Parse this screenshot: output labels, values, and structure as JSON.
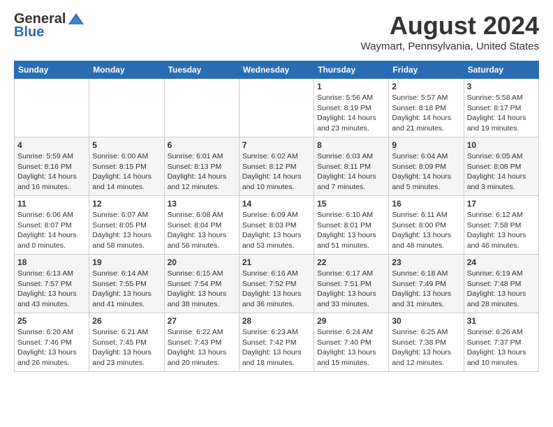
{
  "header": {
    "logo_general": "General",
    "logo_blue": "Blue",
    "month_year": "August 2024",
    "location": "Waymart, Pennsylvania, United States"
  },
  "weekdays": [
    "Sunday",
    "Monday",
    "Tuesday",
    "Wednesday",
    "Thursday",
    "Friday",
    "Saturday"
  ],
  "weeks": [
    [
      {
        "day": "",
        "sunrise": "",
        "sunset": "",
        "daylight": ""
      },
      {
        "day": "",
        "sunrise": "",
        "sunset": "",
        "daylight": ""
      },
      {
        "day": "",
        "sunrise": "",
        "sunset": "",
        "daylight": ""
      },
      {
        "day": "",
        "sunrise": "",
        "sunset": "",
        "daylight": ""
      },
      {
        "day": "1",
        "sunrise": "Sunrise: 5:56 AM",
        "sunset": "Sunset: 8:19 PM",
        "daylight": "Daylight: 14 hours and 23 minutes."
      },
      {
        "day": "2",
        "sunrise": "Sunrise: 5:57 AM",
        "sunset": "Sunset: 8:18 PM",
        "daylight": "Daylight: 14 hours and 21 minutes."
      },
      {
        "day": "3",
        "sunrise": "Sunrise: 5:58 AM",
        "sunset": "Sunset: 8:17 PM",
        "daylight": "Daylight: 14 hours and 19 minutes."
      }
    ],
    [
      {
        "day": "4",
        "sunrise": "Sunrise: 5:59 AM",
        "sunset": "Sunset: 8:16 PM",
        "daylight": "Daylight: 14 hours and 16 minutes."
      },
      {
        "day": "5",
        "sunrise": "Sunrise: 6:00 AM",
        "sunset": "Sunset: 8:15 PM",
        "daylight": "Daylight: 14 hours and 14 minutes."
      },
      {
        "day": "6",
        "sunrise": "Sunrise: 6:01 AM",
        "sunset": "Sunset: 8:13 PM",
        "daylight": "Daylight: 14 hours and 12 minutes."
      },
      {
        "day": "7",
        "sunrise": "Sunrise: 6:02 AM",
        "sunset": "Sunset: 8:12 PM",
        "daylight": "Daylight: 14 hours and 10 minutes."
      },
      {
        "day": "8",
        "sunrise": "Sunrise: 6:03 AM",
        "sunset": "Sunset: 8:11 PM",
        "daylight": "Daylight: 14 hours and 7 minutes."
      },
      {
        "day": "9",
        "sunrise": "Sunrise: 6:04 AM",
        "sunset": "Sunset: 8:09 PM",
        "daylight": "Daylight: 14 hours and 5 minutes."
      },
      {
        "day": "10",
        "sunrise": "Sunrise: 6:05 AM",
        "sunset": "Sunset: 8:08 PM",
        "daylight": "Daylight: 14 hours and 3 minutes."
      }
    ],
    [
      {
        "day": "11",
        "sunrise": "Sunrise: 6:06 AM",
        "sunset": "Sunset: 8:07 PM",
        "daylight": "Daylight: 14 hours and 0 minutes."
      },
      {
        "day": "12",
        "sunrise": "Sunrise: 6:07 AM",
        "sunset": "Sunset: 8:05 PM",
        "daylight": "Daylight: 13 hours and 58 minutes."
      },
      {
        "day": "13",
        "sunrise": "Sunrise: 6:08 AM",
        "sunset": "Sunset: 8:04 PM",
        "daylight": "Daylight: 13 hours and 56 minutes."
      },
      {
        "day": "14",
        "sunrise": "Sunrise: 6:09 AM",
        "sunset": "Sunset: 8:03 PM",
        "daylight": "Daylight: 13 hours and 53 minutes."
      },
      {
        "day": "15",
        "sunrise": "Sunrise: 6:10 AM",
        "sunset": "Sunset: 8:01 PM",
        "daylight": "Daylight: 13 hours and 51 minutes."
      },
      {
        "day": "16",
        "sunrise": "Sunrise: 6:11 AM",
        "sunset": "Sunset: 8:00 PM",
        "daylight": "Daylight: 13 hours and 48 minutes."
      },
      {
        "day": "17",
        "sunrise": "Sunrise: 6:12 AM",
        "sunset": "Sunset: 7:58 PM",
        "daylight": "Daylight: 13 hours and 46 minutes."
      }
    ],
    [
      {
        "day": "18",
        "sunrise": "Sunrise: 6:13 AM",
        "sunset": "Sunset: 7:57 PM",
        "daylight": "Daylight: 13 hours and 43 minutes."
      },
      {
        "day": "19",
        "sunrise": "Sunrise: 6:14 AM",
        "sunset": "Sunset: 7:55 PM",
        "daylight": "Daylight: 13 hours and 41 minutes."
      },
      {
        "day": "20",
        "sunrise": "Sunrise: 6:15 AM",
        "sunset": "Sunset: 7:54 PM",
        "daylight": "Daylight: 13 hours and 38 minutes."
      },
      {
        "day": "21",
        "sunrise": "Sunrise: 6:16 AM",
        "sunset": "Sunset: 7:52 PM",
        "daylight": "Daylight: 13 hours and 36 minutes."
      },
      {
        "day": "22",
        "sunrise": "Sunrise: 6:17 AM",
        "sunset": "Sunset: 7:51 PM",
        "daylight": "Daylight: 13 hours and 33 minutes."
      },
      {
        "day": "23",
        "sunrise": "Sunrise: 6:18 AM",
        "sunset": "Sunset: 7:49 PM",
        "daylight": "Daylight: 13 hours and 31 minutes."
      },
      {
        "day": "24",
        "sunrise": "Sunrise: 6:19 AM",
        "sunset": "Sunset: 7:48 PM",
        "daylight": "Daylight: 13 hours and 28 minutes."
      }
    ],
    [
      {
        "day": "25",
        "sunrise": "Sunrise: 6:20 AM",
        "sunset": "Sunset: 7:46 PM",
        "daylight": "Daylight: 13 hours and 26 minutes."
      },
      {
        "day": "26",
        "sunrise": "Sunrise: 6:21 AM",
        "sunset": "Sunset: 7:45 PM",
        "daylight": "Daylight: 13 hours and 23 minutes."
      },
      {
        "day": "27",
        "sunrise": "Sunrise: 6:22 AM",
        "sunset": "Sunset: 7:43 PM",
        "daylight": "Daylight: 13 hours and 20 minutes."
      },
      {
        "day": "28",
        "sunrise": "Sunrise: 6:23 AM",
        "sunset": "Sunset: 7:42 PM",
        "daylight": "Daylight: 13 hours and 18 minutes."
      },
      {
        "day": "29",
        "sunrise": "Sunrise: 6:24 AM",
        "sunset": "Sunset: 7:40 PM",
        "daylight": "Daylight: 13 hours and 15 minutes."
      },
      {
        "day": "30",
        "sunrise": "Sunrise: 6:25 AM",
        "sunset": "Sunset: 7:38 PM",
        "daylight": "Daylight: 13 hours and 12 minutes."
      },
      {
        "day": "31",
        "sunrise": "Sunrise: 6:26 AM",
        "sunset": "Sunset: 7:37 PM",
        "daylight": "Daylight: 13 hours and 10 minutes."
      }
    ]
  ]
}
